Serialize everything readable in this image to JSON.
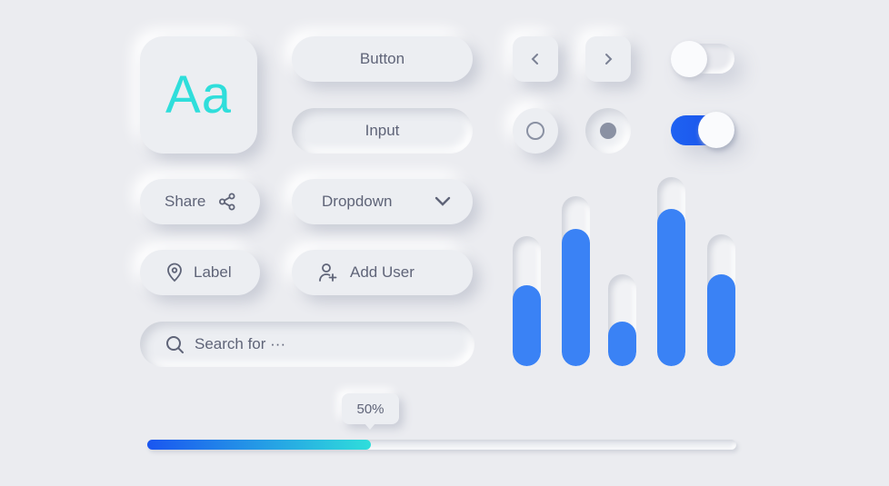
{
  "typography": {
    "sample": "Aa",
    "color": "#2fdedb"
  },
  "buttons": {
    "button": "Button",
    "input": "Input",
    "share": "Share",
    "dropdown": "Dropdown",
    "label": "Label",
    "add_user": "Add User"
  },
  "search": {
    "placeholder": "Search for ···"
  },
  "icons": {
    "prev": "chevron-left-icon",
    "next": "chevron-right-icon",
    "share": "share-icon",
    "dropdown": "chevron-down-icon",
    "label": "map-pin-icon",
    "add_user": "user-plus-icon",
    "search": "search-icon"
  },
  "radios": [
    {
      "checked": false
    },
    {
      "checked": true
    }
  ],
  "toggles": [
    {
      "on": false
    },
    {
      "on": true,
      "color": "#1a56f0"
    }
  ],
  "bars": {
    "color": "#3a82f5",
    "levels": [
      0.62,
      0.81,
      0.49,
      0.83,
      0.7
    ]
  },
  "progress": {
    "tooltip": "50%",
    "fill_percent": 38,
    "gradient": [
      "#1a56f0",
      "#2fdedb"
    ]
  }
}
